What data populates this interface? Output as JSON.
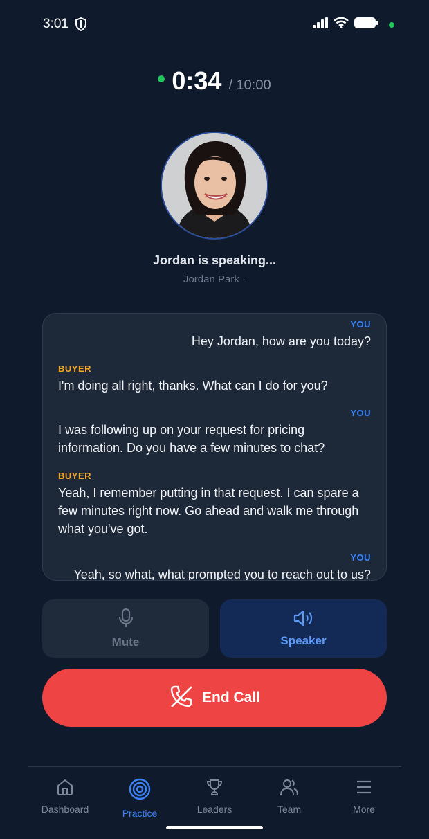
{
  "status_bar": {
    "time": "3:01"
  },
  "timer": {
    "elapsed": "0:34",
    "total": "/ 10:00"
  },
  "caller": {
    "speaking_status": "Jordan is speaking...",
    "name_line": "Jordan Park ·"
  },
  "transcript": [
    {
      "speaker": "YOU",
      "text": "Hey Jordan, how are you today?"
    },
    {
      "speaker": "BUYER",
      "text": "I'm doing all right, thanks. What can I do for you?"
    },
    {
      "speaker": "YOU",
      "text": "I was following up on your request for pricing information. Do you have a few minutes to chat?"
    },
    {
      "speaker": "BUYER",
      "text": "Yeah, I remember putting in that request. I can spare a few minutes right now. Go ahead and walk me through what you've got."
    },
    {
      "speaker": "YOU",
      "text": "Yeah, so what, what prompted you to reach out to us?"
    }
  ],
  "controls": {
    "mute_label": "Mute",
    "speaker_label": "Speaker",
    "end_call_label": "End Call"
  },
  "nav": [
    {
      "label": "Dashboard",
      "icon": "home-icon",
      "active": false
    },
    {
      "label": "Practice",
      "icon": "target-icon",
      "active": true
    },
    {
      "label": "Leaders",
      "icon": "trophy-icon",
      "active": false
    },
    {
      "label": "Team",
      "icon": "users-icon",
      "active": false
    },
    {
      "label": "More",
      "icon": "menu-icon",
      "active": false
    }
  ],
  "colors": {
    "background": "#0f1a2c",
    "you_label": "#3b82f6",
    "buyer_label": "#f5a524",
    "end_call": "#ef4444",
    "live_dot": "#22c55e"
  }
}
